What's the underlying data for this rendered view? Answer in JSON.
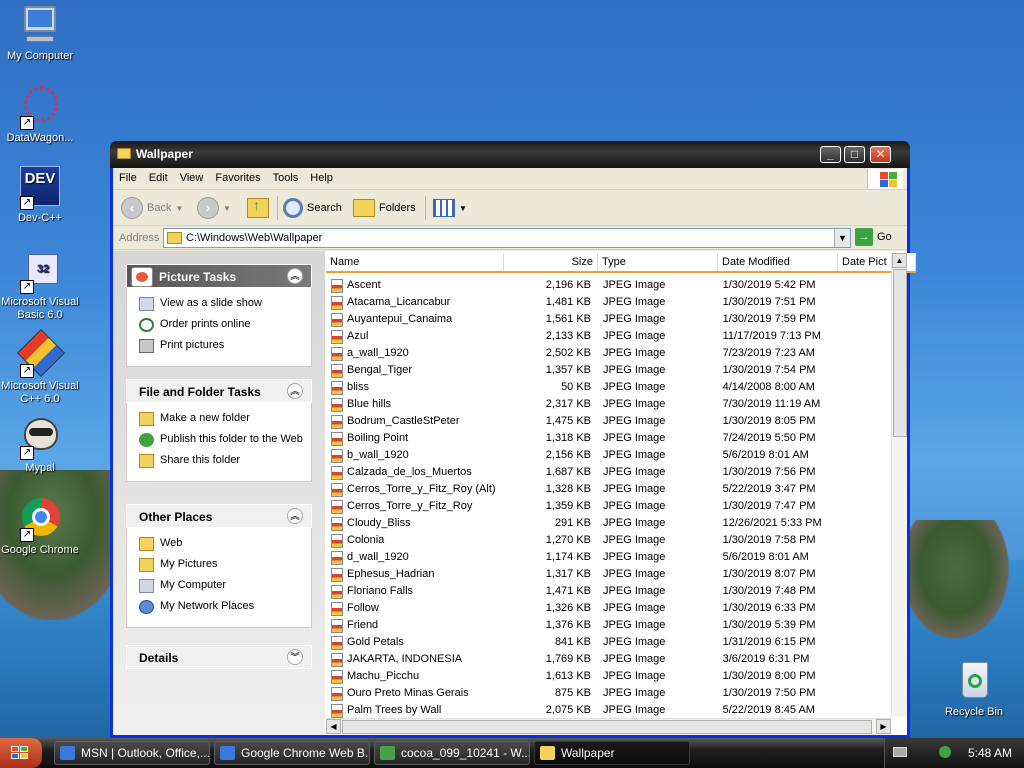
{
  "desktop": {
    "icons": [
      {
        "label": "My Computer"
      },
      {
        "label": "DataWagon..."
      },
      {
        "label": "Dev-C++",
        "badge": "DEV"
      },
      {
        "label": "Microsoft Visual Basic 6.0"
      },
      {
        "label": "Microsoft Visual C++ 6.0"
      },
      {
        "label": "Mypal"
      },
      {
        "label": "Google Chrome"
      },
      {
        "label": "Recycle Bin"
      }
    ]
  },
  "window": {
    "title": "Wallpaper",
    "menu": [
      "File",
      "Edit",
      "View",
      "Favorites",
      "Tools",
      "Help"
    ],
    "toolbar": {
      "back": "Back",
      "search": "Search",
      "folders": "Folders"
    },
    "address": {
      "label": "Address",
      "value": "C:\\Windows\\Web\\Wallpaper",
      "go": "Go"
    },
    "tasks": {
      "picture_tasks": {
        "title": "Picture Tasks",
        "items": [
          "View as a slide show",
          "Order prints online",
          "Print pictures"
        ]
      },
      "file_tasks": {
        "title": "File and Folder Tasks",
        "items": [
          "Make a new folder",
          "Publish this folder to the Web",
          "Share this folder"
        ]
      },
      "other_places": {
        "title": "Other Places",
        "items": [
          "Web",
          "My Pictures",
          "My Computer",
          "My Network Places"
        ]
      },
      "details": {
        "title": "Details"
      }
    },
    "columns": [
      "Name",
      "Size",
      "Type",
      "Date Modified",
      "Date Pict"
    ],
    "files": [
      [
        "Ascent",
        "2,196 KB",
        "JPEG Image",
        "1/30/2019 5:42 PM"
      ],
      [
        "Atacama_Licancabur",
        "1,481 KB",
        "JPEG Image",
        "1/30/2019 7:51 PM"
      ],
      [
        "Auyantepui_Canaima",
        "1,561 KB",
        "JPEG Image",
        "1/30/2019 7:59 PM"
      ],
      [
        "Azul",
        "2,133 KB",
        "JPEG Image",
        "11/17/2019 7:13 PM"
      ],
      [
        "a_wall_1920",
        "2,502 KB",
        "JPEG Image",
        "7/23/2019 7:23 AM"
      ],
      [
        "Bengal_Tiger",
        "1,357 KB",
        "JPEG Image",
        "1/30/2019 7:54 PM"
      ],
      [
        "bliss",
        "50 KB",
        "JPEG Image",
        "4/14/2008 8:00 AM"
      ],
      [
        "Blue hills",
        "2,317 KB",
        "JPEG Image",
        "7/30/2019 11:19 AM"
      ],
      [
        "Bodrum_CastleStPeter",
        "1,475 KB",
        "JPEG Image",
        "1/30/2019 8:05 PM"
      ],
      [
        "Boiling Point",
        "1,318 KB",
        "JPEG Image",
        "7/24/2019 5:50 PM"
      ],
      [
        "b_wall_1920",
        "2,156 KB",
        "JPEG Image",
        "5/6/2019 8:01 AM"
      ],
      [
        "Calzada_de_los_Muertos",
        "1,687 KB",
        "JPEG Image",
        "1/30/2019 7:56 PM"
      ],
      [
        "Cerros_Torre_y_Fitz_Roy (Alt)",
        "1,328 KB",
        "JPEG Image",
        "5/22/2019 3:47 PM"
      ],
      [
        "Cerros_Torre_y_Fitz_Roy",
        "1,359 KB",
        "JPEG Image",
        "1/30/2019 7:47 PM"
      ],
      [
        "Cloudy_Bliss",
        "291 KB",
        "JPEG Image",
        "12/26/2021 5:33 PM"
      ],
      [
        "Colonia",
        "1,270 KB",
        "JPEG Image",
        "1/30/2019 7:58 PM"
      ],
      [
        "d_wall_1920",
        "1,174 KB",
        "JPEG Image",
        "5/6/2019 8:01 AM"
      ],
      [
        "Ephesus_Hadrian",
        "1,317 KB",
        "JPEG Image",
        "1/30/2019 8:07 PM"
      ],
      [
        "Floriano Falls",
        "1,471 KB",
        "JPEG Image",
        "1/30/2019 7:48 PM"
      ],
      [
        "Follow",
        "1,326 KB",
        "JPEG Image",
        "1/30/2019 6:33 PM"
      ],
      [
        "Friend",
        "1,376 KB",
        "JPEG Image",
        "1/30/2019 5:39 PM"
      ],
      [
        "Gold Petals",
        "841 KB",
        "JPEG Image",
        "1/31/2019 6:15 PM"
      ],
      [
        "JAKARTA, INDONESIA",
        "1,769 KB",
        "JPEG Image",
        "3/6/2019 6:31 PM"
      ],
      [
        "Machu_Picchu",
        "1,613 KB",
        "JPEG Image",
        "1/30/2019 8:00 PM"
      ],
      [
        "Ouro Preto Minas Gerais",
        "875 KB",
        "JPEG Image",
        "1/30/2019 7:50 PM"
      ],
      [
        "Palm Trees by Wall",
        "2,075 KB",
        "JPEG Image",
        "5/22/2019 8:45 AM"
      ]
    ]
  },
  "taskbar": {
    "items": [
      "MSN | Outlook, Office,...",
      "Google Chrome Web B...",
      "cocoa_099_10241 - W...",
      "Wallpaper"
    ],
    "clock": "5:48 AM"
  }
}
